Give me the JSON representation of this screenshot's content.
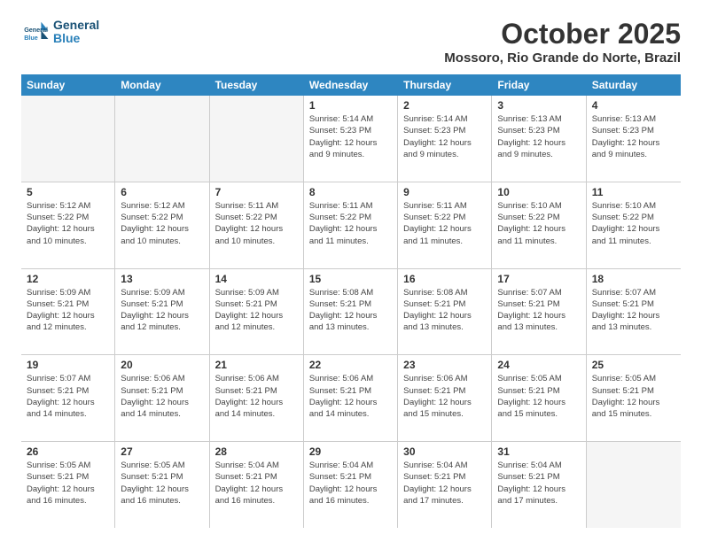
{
  "header": {
    "logo_line1": "General",
    "logo_line2": "Blue",
    "month": "October 2025",
    "location": "Mossoro, Rio Grande do Norte, Brazil"
  },
  "weekdays": [
    "Sunday",
    "Monday",
    "Tuesday",
    "Wednesday",
    "Thursday",
    "Friday",
    "Saturday"
  ],
  "weeks": [
    [
      {
        "day": "",
        "info": "",
        "empty": true
      },
      {
        "day": "",
        "info": "",
        "empty": true
      },
      {
        "day": "",
        "info": "",
        "empty": true
      },
      {
        "day": "1",
        "info": "Sunrise: 5:14 AM\nSunset: 5:23 PM\nDaylight: 12 hours\nand 9 minutes."
      },
      {
        "day": "2",
        "info": "Sunrise: 5:14 AM\nSunset: 5:23 PM\nDaylight: 12 hours\nand 9 minutes."
      },
      {
        "day": "3",
        "info": "Sunrise: 5:13 AM\nSunset: 5:23 PM\nDaylight: 12 hours\nand 9 minutes."
      },
      {
        "day": "4",
        "info": "Sunrise: 5:13 AM\nSunset: 5:23 PM\nDaylight: 12 hours\nand 9 minutes."
      }
    ],
    [
      {
        "day": "5",
        "info": "Sunrise: 5:12 AM\nSunset: 5:22 PM\nDaylight: 12 hours\nand 10 minutes."
      },
      {
        "day": "6",
        "info": "Sunrise: 5:12 AM\nSunset: 5:22 PM\nDaylight: 12 hours\nand 10 minutes."
      },
      {
        "day": "7",
        "info": "Sunrise: 5:11 AM\nSunset: 5:22 PM\nDaylight: 12 hours\nand 10 minutes."
      },
      {
        "day": "8",
        "info": "Sunrise: 5:11 AM\nSunset: 5:22 PM\nDaylight: 12 hours\nand 11 minutes."
      },
      {
        "day": "9",
        "info": "Sunrise: 5:11 AM\nSunset: 5:22 PM\nDaylight: 12 hours\nand 11 minutes."
      },
      {
        "day": "10",
        "info": "Sunrise: 5:10 AM\nSunset: 5:22 PM\nDaylight: 12 hours\nand 11 minutes."
      },
      {
        "day": "11",
        "info": "Sunrise: 5:10 AM\nSunset: 5:22 PM\nDaylight: 12 hours\nand 11 minutes."
      }
    ],
    [
      {
        "day": "12",
        "info": "Sunrise: 5:09 AM\nSunset: 5:21 PM\nDaylight: 12 hours\nand 12 minutes."
      },
      {
        "day": "13",
        "info": "Sunrise: 5:09 AM\nSunset: 5:21 PM\nDaylight: 12 hours\nand 12 minutes."
      },
      {
        "day": "14",
        "info": "Sunrise: 5:09 AM\nSunset: 5:21 PM\nDaylight: 12 hours\nand 12 minutes."
      },
      {
        "day": "15",
        "info": "Sunrise: 5:08 AM\nSunset: 5:21 PM\nDaylight: 12 hours\nand 13 minutes."
      },
      {
        "day": "16",
        "info": "Sunrise: 5:08 AM\nSunset: 5:21 PM\nDaylight: 12 hours\nand 13 minutes."
      },
      {
        "day": "17",
        "info": "Sunrise: 5:07 AM\nSunset: 5:21 PM\nDaylight: 12 hours\nand 13 minutes."
      },
      {
        "day": "18",
        "info": "Sunrise: 5:07 AM\nSunset: 5:21 PM\nDaylight: 12 hours\nand 13 minutes."
      }
    ],
    [
      {
        "day": "19",
        "info": "Sunrise: 5:07 AM\nSunset: 5:21 PM\nDaylight: 12 hours\nand 14 minutes."
      },
      {
        "day": "20",
        "info": "Sunrise: 5:06 AM\nSunset: 5:21 PM\nDaylight: 12 hours\nand 14 minutes."
      },
      {
        "day": "21",
        "info": "Sunrise: 5:06 AM\nSunset: 5:21 PM\nDaylight: 12 hours\nand 14 minutes."
      },
      {
        "day": "22",
        "info": "Sunrise: 5:06 AM\nSunset: 5:21 PM\nDaylight: 12 hours\nand 14 minutes."
      },
      {
        "day": "23",
        "info": "Sunrise: 5:06 AM\nSunset: 5:21 PM\nDaylight: 12 hours\nand 15 minutes."
      },
      {
        "day": "24",
        "info": "Sunrise: 5:05 AM\nSunset: 5:21 PM\nDaylight: 12 hours\nand 15 minutes."
      },
      {
        "day": "25",
        "info": "Sunrise: 5:05 AM\nSunset: 5:21 PM\nDaylight: 12 hours\nand 15 minutes."
      }
    ],
    [
      {
        "day": "26",
        "info": "Sunrise: 5:05 AM\nSunset: 5:21 PM\nDaylight: 12 hours\nand 16 minutes."
      },
      {
        "day": "27",
        "info": "Sunrise: 5:05 AM\nSunset: 5:21 PM\nDaylight: 12 hours\nand 16 minutes."
      },
      {
        "day": "28",
        "info": "Sunrise: 5:04 AM\nSunset: 5:21 PM\nDaylight: 12 hours\nand 16 minutes."
      },
      {
        "day": "29",
        "info": "Sunrise: 5:04 AM\nSunset: 5:21 PM\nDaylight: 12 hours\nand 16 minutes."
      },
      {
        "day": "30",
        "info": "Sunrise: 5:04 AM\nSunset: 5:21 PM\nDaylight: 12 hours\nand 17 minutes."
      },
      {
        "day": "31",
        "info": "Sunrise: 5:04 AM\nSunset: 5:21 PM\nDaylight: 12 hours\nand 17 minutes."
      },
      {
        "day": "",
        "info": "",
        "empty": true
      }
    ]
  ]
}
